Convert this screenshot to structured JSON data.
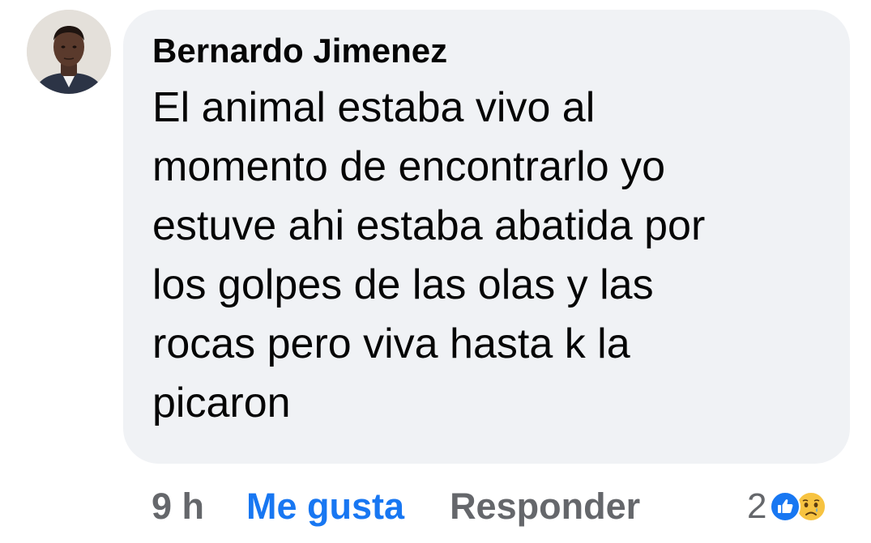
{
  "comment": {
    "author": "Bernardo Jimenez",
    "text_lines": [
      "El animal estaba vivo al",
      "momento de encontrarlo yo",
      "estuve ahi estaba abatida por",
      "los golpes de las olas y las",
      "rocas pero viva hasta k la",
      "picaron"
    ],
    "time": "9 h",
    "like_label": "Me gusta",
    "reply_label": "Responder",
    "reaction_count": "2",
    "reaction_icons": [
      "like-icon",
      "sad-face-icon"
    ]
  },
  "colors": {
    "bubble_bg": "#f0f2f5",
    "text": "#050505",
    "secondary": "#65676b",
    "like_blue": "#1877f2",
    "sad_yellow": "#f7c341"
  }
}
